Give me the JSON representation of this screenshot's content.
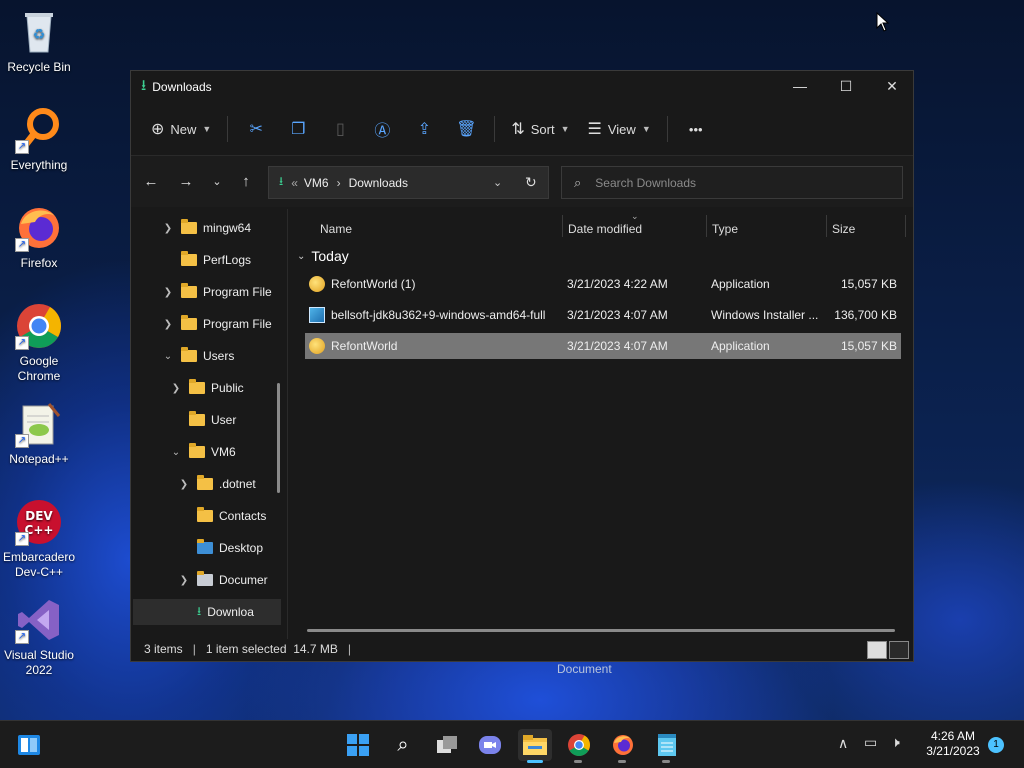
{
  "desktop": {
    "icons": [
      {
        "label": "Recycle Bin"
      },
      {
        "label": "Everything"
      },
      {
        "label": "Firefox"
      },
      {
        "label": "Google Chrome"
      },
      {
        "label": "Notepad++"
      },
      {
        "label": "Embarcadero Dev-C++"
      },
      {
        "label": "Visual Studio 2022"
      }
    ],
    "behind_label": "Document"
  },
  "window": {
    "title": "Downloads",
    "controls": {
      "minimize": "—",
      "maximize": "☐",
      "close": "✕"
    }
  },
  "toolbar": {
    "new_label": "New",
    "sort_label": "Sort",
    "view_label": "View",
    "more_label": "•••"
  },
  "address": {
    "overflow": "«",
    "crumbs": [
      "VM6",
      "Downloads"
    ]
  },
  "search": {
    "placeholder": "Search Downloads"
  },
  "tree": {
    "items": [
      {
        "label": "mingw64",
        "expandable": true
      },
      {
        "label": "PerfLogs",
        "expandable": false
      },
      {
        "label": "Program File",
        "expandable": true
      },
      {
        "label": "Program File",
        "expandable": true
      },
      {
        "label": "Users",
        "expandable": true,
        "expanded": true
      },
      {
        "label": "Public",
        "expandable": true
      },
      {
        "label": "User",
        "expandable": false
      },
      {
        "label": "VM6",
        "expandable": true,
        "expanded": true
      },
      {
        "label": ".dotnet",
        "expandable": true
      },
      {
        "label": "Contacts",
        "expandable": false
      },
      {
        "label": "Desktop",
        "expandable": false
      },
      {
        "label": "Documer",
        "expandable": true
      },
      {
        "label": "Downloa",
        "expandable": false,
        "selected": true
      }
    ]
  },
  "list": {
    "columns": {
      "name": "Name",
      "date": "Date modified",
      "type": "Type",
      "size": "Size"
    },
    "group": "Today",
    "rows": [
      {
        "name": "RefontWorld (1)",
        "date": "3/21/2023 4:22 AM",
        "type": "Application",
        "size": "15,057 KB",
        "icon": "app-icon"
      },
      {
        "name": "bellsoft-jdk8u362+9-windows-amd64-full",
        "date": "3/21/2023 4:07 AM",
        "type": "Windows Installer ...",
        "size": "136,700 KB",
        "icon": "installer-icon"
      },
      {
        "name": "RefontWorld",
        "date": "3/21/2023 4:07 AM",
        "type": "Application",
        "size": "15,057 KB",
        "icon": "app-icon",
        "selected": true
      }
    ]
  },
  "status": {
    "count": "3 items",
    "selection": "1 item selected  14.7 MB",
    "sep": "|"
  },
  "taskbar": {
    "time": "4:26 AM",
    "date": "3/21/2023",
    "notifications": "1"
  }
}
